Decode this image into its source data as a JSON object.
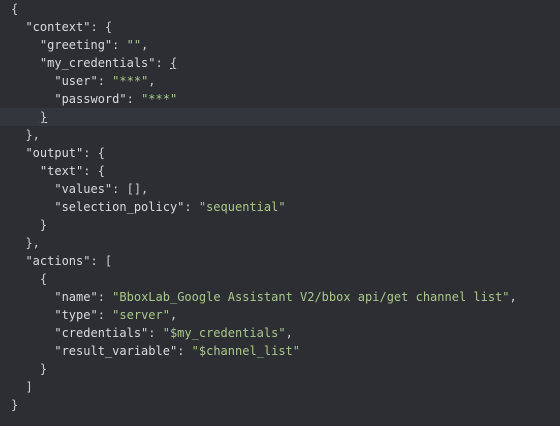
{
  "editor": {
    "lines": [
      {
        "indent": "",
        "parts": [
          {
            "t": "{",
            "c": "punc"
          }
        ]
      },
      {
        "indent": "  ",
        "parts": [
          {
            "t": "\"context\"",
            "c": "key"
          },
          {
            "t": ": {",
            "c": "punc"
          }
        ]
      },
      {
        "indent": "    ",
        "parts": [
          {
            "t": "\"greeting\"",
            "c": "key"
          },
          {
            "t": ": ",
            "c": "punc"
          },
          {
            "t": "\"\"",
            "c": "str"
          },
          {
            "t": ",",
            "c": "punc"
          }
        ]
      },
      {
        "indent": "    ",
        "parts": [
          {
            "t": "\"my_credentials\"",
            "c": "key"
          },
          {
            "t": ": ",
            "c": "punc"
          },
          {
            "t": "{",
            "c": "punc",
            "u": true
          }
        ]
      },
      {
        "indent": "      ",
        "parts": [
          {
            "t": "\"user\"",
            "c": "key"
          },
          {
            "t": ": ",
            "c": "punc"
          },
          {
            "t": "\"***\"",
            "c": "str"
          },
          {
            "t": ",",
            "c": "punc"
          }
        ]
      },
      {
        "indent": "      ",
        "parts": [
          {
            "t": "\"password\"",
            "c": "key"
          },
          {
            "t": ": ",
            "c": "punc"
          },
          {
            "t": "\"***\"",
            "c": "str"
          }
        ]
      },
      {
        "indent": "    ",
        "parts": [
          {
            "t": "}",
            "c": "punc",
            "u": true
          }
        ],
        "active": true
      },
      {
        "indent": "  ",
        "parts": [
          {
            "t": "},",
            "c": "punc"
          }
        ]
      },
      {
        "indent": "  ",
        "parts": [
          {
            "t": "\"output\"",
            "c": "key"
          },
          {
            "t": ": {",
            "c": "punc"
          }
        ]
      },
      {
        "indent": "    ",
        "parts": [
          {
            "t": "\"text\"",
            "c": "key"
          },
          {
            "t": ": {",
            "c": "punc"
          }
        ]
      },
      {
        "indent": "      ",
        "parts": [
          {
            "t": "\"values\"",
            "c": "key"
          },
          {
            "t": ": [],",
            "c": "punc"
          }
        ]
      },
      {
        "indent": "      ",
        "parts": [
          {
            "t": "\"selection_policy\"",
            "c": "key"
          },
          {
            "t": ": ",
            "c": "punc"
          },
          {
            "t": "\"sequential\"",
            "c": "str"
          }
        ]
      },
      {
        "indent": "    ",
        "parts": [
          {
            "t": "}",
            "c": "punc"
          }
        ]
      },
      {
        "indent": "  ",
        "parts": [
          {
            "t": "},",
            "c": "punc"
          }
        ]
      },
      {
        "indent": "  ",
        "parts": [
          {
            "t": "\"actions\"",
            "c": "key"
          },
          {
            "t": ": [",
            "c": "punc"
          }
        ]
      },
      {
        "indent": "    ",
        "parts": [
          {
            "t": "{",
            "c": "punc"
          }
        ]
      },
      {
        "indent": "      ",
        "parts": [
          {
            "t": "\"name\"",
            "c": "key"
          },
          {
            "t": ": ",
            "c": "punc"
          },
          {
            "t": "\"BboxLab_Google Assistant V2/bbox api/get channel list\"",
            "c": "str"
          },
          {
            "t": ",",
            "c": "punc"
          }
        ]
      },
      {
        "indent": "      ",
        "parts": [
          {
            "t": "\"type\"",
            "c": "key"
          },
          {
            "t": ": ",
            "c": "punc"
          },
          {
            "t": "\"server\"",
            "c": "str"
          },
          {
            "t": ",",
            "c": "punc"
          }
        ]
      },
      {
        "indent": "      ",
        "parts": [
          {
            "t": "\"credentials\"",
            "c": "key"
          },
          {
            "t": ": ",
            "c": "punc"
          },
          {
            "t": "\"$my_credentials\"",
            "c": "str"
          },
          {
            "t": ",",
            "c": "punc"
          }
        ]
      },
      {
        "indent": "      ",
        "parts": [
          {
            "t": "\"result_variable\"",
            "c": "key"
          },
          {
            "t": ": ",
            "c": "punc"
          },
          {
            "t": "\"$channel_list\"",
            "c": "str"
          }
        ]
      },
      {
        "indent": "    ",
        "parts": [
          {
            "t": "}",
            "c": "punc"
          }
        ]
      },
      {
        "indent": "  ",
        "parts": [
          {
            "t": "]",
            "c": "punc"
          }
        ]
      },
      {
        "indent": "",
        "parts": [
          {
            "t": "}",
            "c": "punc"
          }
        ]
      }
    ]
  },
  "colors": {
    "background": "#2c2e33",
    "active_line": "#33363c",
    "key": "#d7dade",
    "string": "#a9c98a"
  }
}
